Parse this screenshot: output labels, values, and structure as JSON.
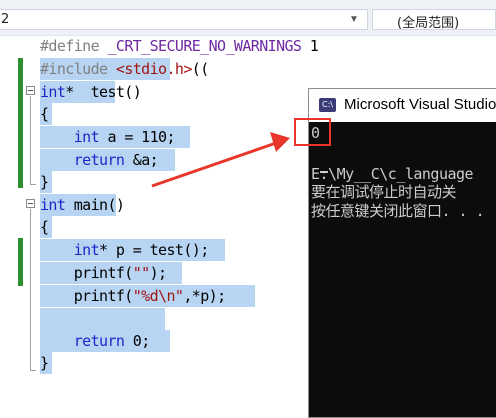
{
  "toolbar": {
    "scope_combo_value": "2",
    "scope_dropdown_icon": "chevron-down-icon",
    "function_combo_value": "(全局范围)"
  },
  "editor": {
    "lines": [
      {
        "id": "l1",
        "tokens": [
          {
            "t": "#define ",
            "c": "pp"
          },
          {
            "t": "_CRT_SECURE_NO_WARNINGS",
            "c": "macro"
          },
          {
            "t": " 1",
            "c": "id"
          }
        ]
      },
      {
        "id": "l2",
        "tokens": [
          {
            "t": "#include ",
            "c": "pp"
          },
          {
            "t": "<stdio.h>",
            "c": "hdr"
          },
          {
            "t": "((",
            "c": "id"
          }
        ]
      },
      {
        "id": "l3",
        "tokens": [
          {
            "t": "int",
            "c": "kw"
          },
          {
            "t": "*  test()",
            "c": "id"
          }
        ]
      },
      {
        "id": "l4",
        "tokens": [
          {
            "t": "{",
            "c": "id"
          }
        ]
      },
      {
        "id": "l5",
        "tokens": [
          {
            "t": "    ",
            "c": "id"
          },
          {
            "t": "int",
            "c": "kw"
          },
          {
            "t": " a = 110;",
            "c": "id"
          }
        ]
      },
      {
        "id": "l6",
        "tokens": [
          {
            "t": "    ",
            "c": "id"
          },
          {
            "t": "return",
            "c": "kw"
          },
          {
            "t": " &a;",
            "c": "id"
          }
        ]
      },
      {
        "id": "l7",
        "tokens": [
          {
            "t": "}",
            "c": "id"
          }
        ]
      },
      {
        "id": "l8",
        "tokens": [
          {
            "t": "int",
            "c": "kw"
          },
          {
            "t": " main()",
            "c": "id"
          }
        ]
      },
      {
        "id": "l9",
        "tokens": [
          {
            "t": "{",
            "c": "id"
          }
        ]
      },
      {
        "id": "l10",
        "tokens": [
          {
            "t": "    ",
            "c": "id"
          },
          {
            "t": "int",
            "c": "kw"
          },
          {
            "t": "* p = test();",
            "c": "id"
          }
        ]
      },
      {
        "id": "l11",
        "tokens": [
          {
            "t": "    printf(",
            "c": "id"
          },
          {
            "t": "\"\"",
            "c": "str"
          },
          {
            "t": ");",
            "c": "id"
          }
        ]
      },
      {
        "id": "l12",
        "tokens": [
          {
            "t": "    printf(",
            "c": "id"
          },
          {
            "t": "\"%d\\n\"",
            "c": "str"
          },
          {
            "t": ",*p);",
            "c": "id"
          }
        ]
      },
      {
        "id": "l13",
        "tokens": [
          {
            "t": "",
            "c": "id"
          }
        ]
      },
      {
        "id": "l14",
        "tokens": [
          {
            "t": "    ",
            "c": "id"
          },
          {
            "t": "return",
            "c": "kw"
          },
          {
            "t": " 0;",
            "c": "id"
          }
        ]
      },
      {
        "id": "l15",
        "tokens": [
          {
            "t": "}",
            "c": "id"
          }
        ]
      }
    ],
    "colors": {
      "preprocessor": "#808080",
      "keyword": "#1f25c9",
      "string": "#a31515",
      "macro": "#6f2aa1",
      "selection": "#b7d5f2",
      "change_bar": "#2f8f2f"
    }
  },
  "console": {
    "icon": "console-app-icon",
    "icon_text": "C:\\",
    "title": "Microsoft Visual Studio",
    "lines": [
      "0",
      "",
      "E:\\My__C\\c_language",
      "要在调试停止时自动关",
      "按任意键关闭此窗口. . ."
    ]
  },
  "annotation": {
    "arrow_color": "#e8362b",
    "box_color": "#e8362b"
  }
}
